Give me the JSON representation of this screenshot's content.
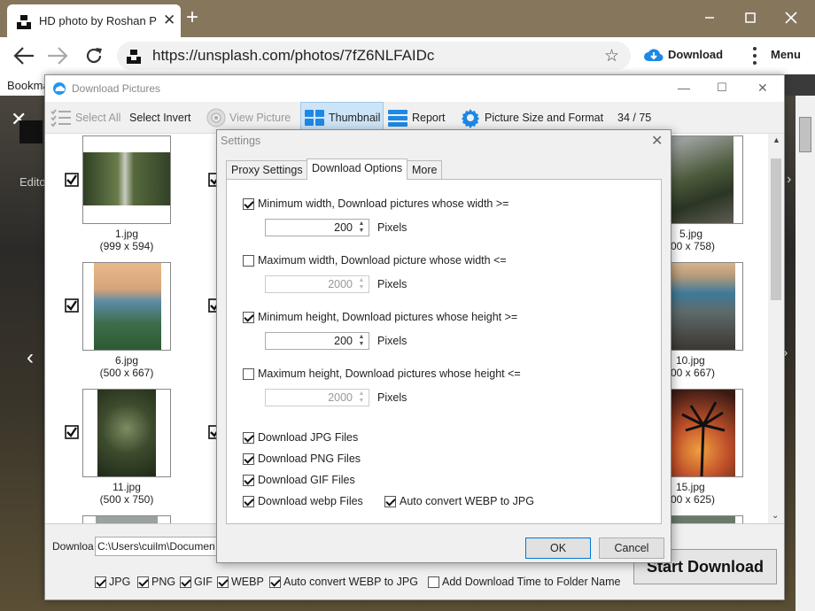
{
  "browser": {
    "tab_title": "HD photo by Roshan P",
    "tab_close": "✕",
    "new_tab": "+",
    "url": "https://unsplash.com/photos/7fZ6NLFAIDc",
    "download_label": "Download",
    "menu_label": "Menu",
    "bookmarks_label": "Bookmarks"
  },
  "page": {
    "edit_label": "Edito"
  },
  "download_window": {
    "title": "Download Pictures",
    "toolbar": {
      "select_all": "Select All",
      "select_invert": "Select Invert",
      "view_picture": "View Picture",
      "thumbnail": "Thumbnail",
      "report": "Report",
      "size_format": "Picture Size and Format",
      "count": "34 / 75"
    },
    "thumbnails": [
      {
        "name": "1.jpg",
        "dims": "(999 x 594)"
      },
      {
        "name": "5.jpg",
        "dims": "00 x 758)"
      },
      {
        "name": "6.jpg",
        "dims": "(500 x 667)"
      },
      {
        "name": "10.jpg",
        "dims": "00 x 667)"
      },
      {
        "name": "11.jpg",
        "dims": "(500 x 750)"
      },
      {
        "name": "15.jpg",
        "dims": "00 x 625)"
      }
    ],
    "download_label": "Downloa",
    "download_path": "C:\\Users\\cuilm\\Documen",
    "formats": {
      "jpg": "JPG",
      "png": "PNG",
      "gif": "GIF",
      "webp": "WEBP",
      "auto_convert": "Auto convert WEBP to JPG",
      "add_time": "Add Download Time to Folder Name"
    },
    "start_download": "Start Download"
  },
  "settings": {
    "title": "Settings",
    "tabs": [
      "Proxy Settings",
      "Download Options",
      "More"
    ],
    "min_width_label": "Minimum width, Download pictures whose width >=",
    "min_width_value": "200",
    "max_width_label": "Maximum width, Download picture whose width <=",
    "max_width_value": "2000",
    "min_height_label": "Minimum height, Download pictures whose height >=",
    "min_height_value": "200",
    "max_height_label": "Maximum height, Download pictures whose height <=",
    "max_height_value": "2000",
    "pixels": "Pixels",
    "dl_jpg": "Download JPG Files",
    "dl_png": "Download PNG Files",
    "dl_gif": "Download GIF Files",
    "dl_webp": "Download webp Files",
    "auto_convert": "Auto convert WEBP to JPG",
    "ok": "OK",
    "cancel": "Cancel"
  },
  "colors": {
    "tabbar": "#86765c",
    "accent": "#0078d7",
    "selected_tool": "#cce4f7"
  }
}
